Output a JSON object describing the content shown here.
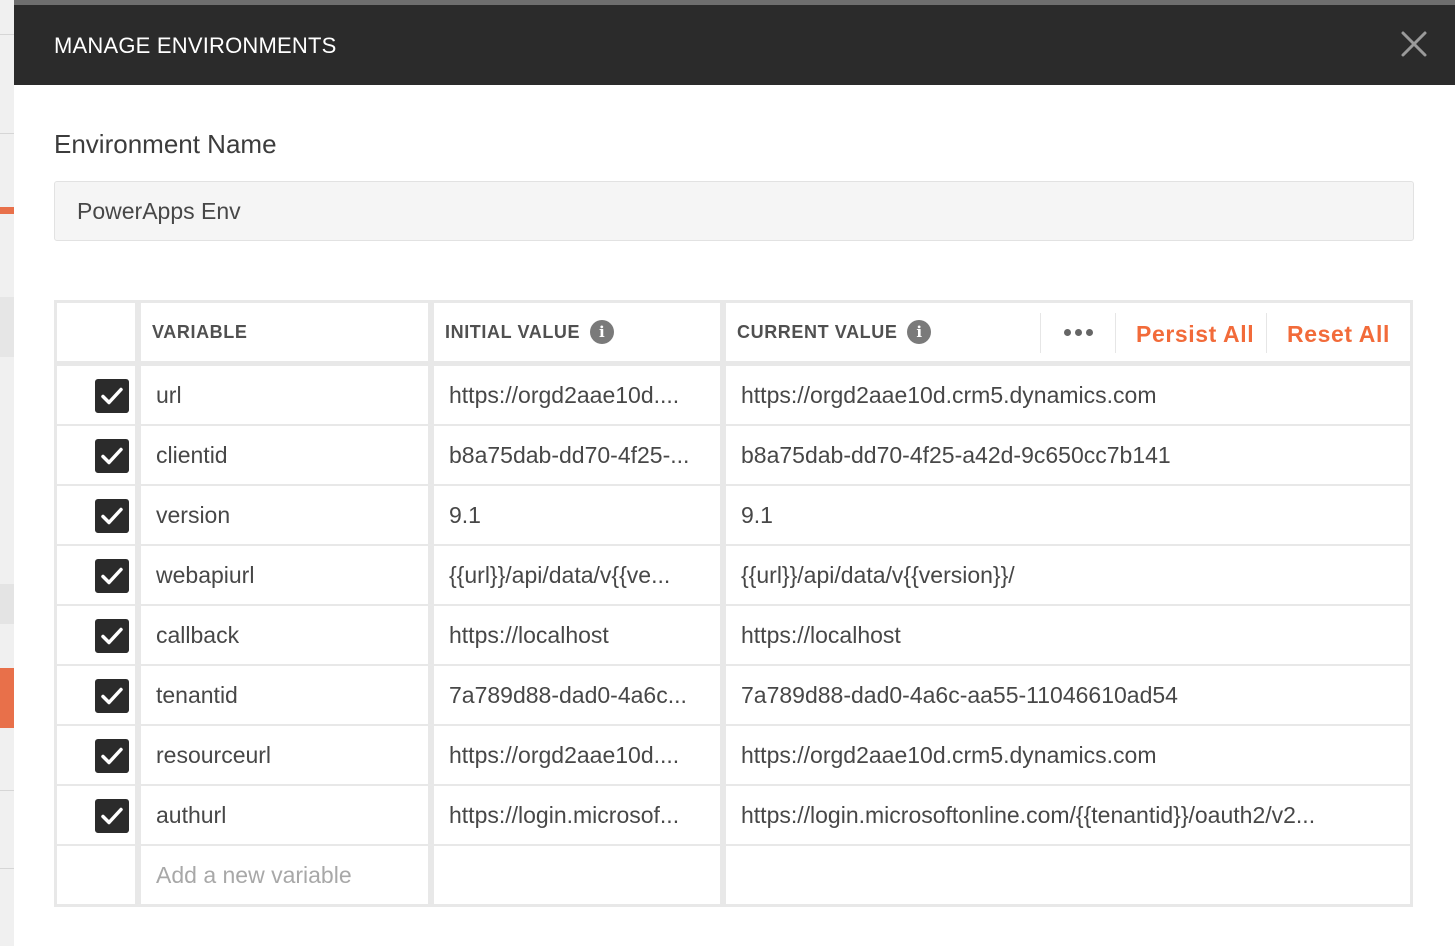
{
  "dialog": {
    "title": "MANAGE ENVIRONMENTS",
    "env_label": "Environment Name",
    "env_name": "PowerApps Env"
  },
  "table": {
    "headers": {
      "variable": "VARIABLE",
      "initial_value": "INITIAL VALUE",
      "current_value": "CURRENT VALUE",
      "info_glyph": "i"
    },
    "actions": {
      "persist_all": "Persist All",
      "reset_all": "Reset All"
    },
    "rows": [
      {
        "enabled": true,
        "variable": "url",
        "initial": "https://orgd2aae10d....",
        "current": "https://orgd2aae10d.crm5.dynamics.com"
      },
      {
        "enabled": true,
        "variable": "clientid",
        "initial": "b8a75dab-dd70-4f25-...",
        "current": "b8a75dab-dd70-4f25-a42d-9c650cc7b141"
      },
      {
        "enabled": true,
        "variable": "version",
        "initial": "9.1",
        "current": "9.1"
      },
      {
        "enabled": true,
        "variable": "webapiurl",
        "initial": "{{url}}/api/data/v{{ve...",
        "current": "{{url}}/api/data/v{{version}}/"
      },
      {
        "enabled": true,
        "variable": "callback",
        "initial": "https://localhost",
        "current": "https://localhost"
      },
      {
        "enabled": true,
        "variable": "tenantid",
        "initial": "7a789d88-dad0-4a6c...",
        "current": "7a789d88-dad0-4a6c-aa55-11046610ad54"
      },
      {
        "enabled": true,
        "variable": "resourceurl",
        "initial": "https://orgd2aae10d....",
        "current": "https://orgd2aae10d.crm5.dynamics.com"
      },
      {
        "enabled": true,
        "variable": "authurl",
        "initial": "https://login.microsof...",
        "current": "https://login.microsoftonline.com/{{tenantid}}/oauth2/v2..."
      }
    ],
    "new_variable_placeholder": "Add a new variable"
  },
  "icons": {
    "close": "close-icon",
    "check": "check-icon",
    "more": "more-horizontal-icon",
    "info": "info-icon"
  },
  "colors": {
    "header_bg": "#2b2b2b",
    "accent": "#f26b3a",
    "checkbox": "#2b2b2b"
  }
}
